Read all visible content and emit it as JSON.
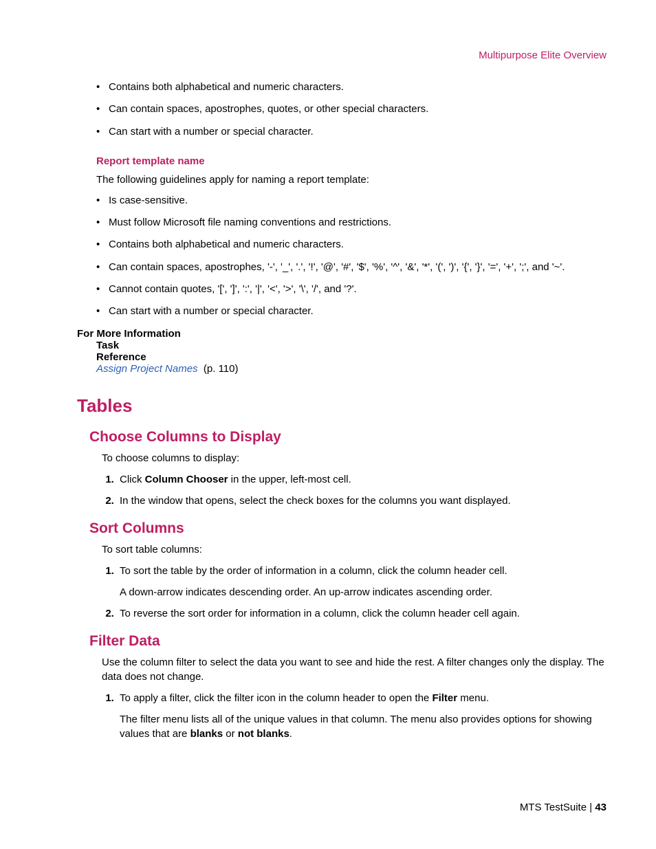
{
  "header": {
    "link": "Multipurpose Elite Overview"
  },
  "topBullets": [
    "Contains both alphabetical and numeric characters.",
    "Can contain spaces, apostrophes, quotes, or other special characters.",
    "Can start with a number or special character."
  ],
  "reportTemplate": {
    "heading": "Report template name",
    "intro": "The following guidelines apply for naming a report template:",
    "bullets": [
      "Is case-sensitive.",
      "Must follow Microsoft file naming conventions and restrictions.",
      "Contains both alphabetical and numeric characters.",
      "Can contain spaces, apostrophes, '-', '_', '.', '!', '@', '#', '$', '%', '^', '&', '*', '(', ')', '{', '}', '=', '+', ';', and '~'.",
      "Cannot contain quotes, '[', ']', ':', '|', '<', '>', '\\', '/', and '?'.",
      "Can start with a number or special character."
    ]
  },
  "moreInfo": {
    "title": "For More Information",
    "task": "Task",
    "reference": "Reference",
    "linkText": "Assign Project Names",
    "linkPage": "(p. 110)"
  },
  "tables": {
    "heading": "Tables",
    "choose": {
      "heading": "Choose Columns to Display",
      "intro": "To choose columns to display:",
      "step1_pre": "Click ",
      "step1_bold": "Column Chooser",
      "step1_post": " in the upper, left-most cell.",
      "step2": "In the window that opens, select the check boxes for the columns you want displayed."
    },
    "sort": {
      "heading": "Sort Columns",
      "intro": "To sort table columns:",
      "step1a": "To sort the table by the order of information in a column, click the column header cell.",
      "step1b": "A down-arrow indicates descending order. An up-arrow indicates ascending order.",
      "step2": "To reverse the sort order for information in a column, click the column header cell again."
    },
    "filter": {
      "heading": "Filter Data",
      "intro": "Use the column filter to select the data you want to see and hide the rest. A filter changes only the display. The data does not change.",
      "step1_pre": "To apply a filter, click the filter icon in the column header to open the ",
      "step1_bold": "Filter",
      "step1_post": " menu.",
      "step1b_pre": "The filter menu lists all of the unique values in that column. The menu also provides options for showing values that are ",
      "step1b_bold1": "blanks",
      "step1b_mid": " or ",
      "step1b_bold2": "not blanks",
      "step1b_post": "."
    }
  },
  "footer": {
    "product": "MTS TestSuite",
    "sep": " | ",
    "page": "43"
  }
}
